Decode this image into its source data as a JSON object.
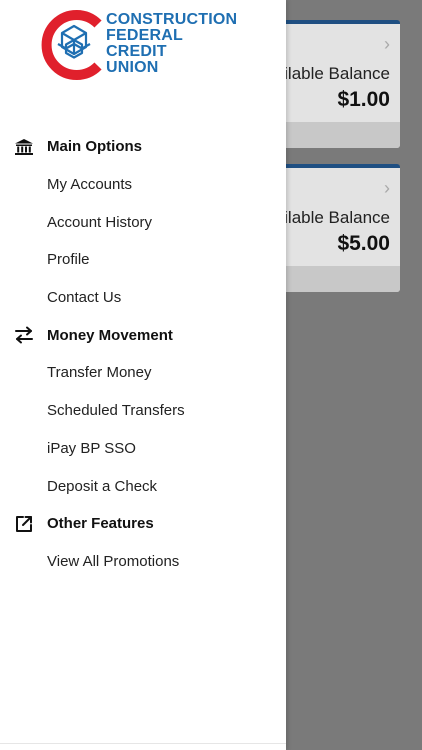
{
  "brand": {
    "line1": "CONSTRUCTION",
    "line2": "FEDERAL",
    "line3": "CREDIT",
    "line4": "UNION",
    "colors": {
      "red": "#e0202c",
      "blue": "#1f6fb2"
    }
  },
  "accounts": [
    {
      "label": "nilable Balance",
      "value": "$1.00"
    },
    {
      "label": "nilable Balance",
      "value": "$5.00"
    }
  ],
  "menu": {
    "main_options": {
      "title": "Main Options",
      "icon": "bank-icon",
      "items": [
        "My Accounts",
        "Account History",
        "Profile",
        "Contact Us"
      ]
    },
    "money_movement": {
      "title": "Money Movement",
      "icon": "transfer-arrows-icon",
      "items": [
        "Transfer Money",
        "Scheduled Transfers",
        "iPay BP SSO",
        "Deposit a Check"
      ]
    },
    "other_features": {
      "title": "Other Features",
      "icon": "external-link-icon",
      "items": [
        "View All Promotions"
      ]
    }
  }
}
